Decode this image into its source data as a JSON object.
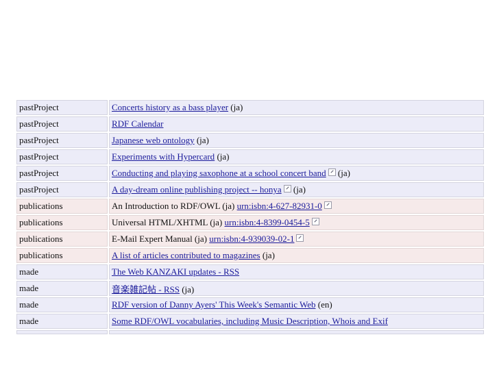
{
  "rows": [
    {
      "prop": "pastProject",
      "link": "Concerts history as a bass player",
      "suffix": " (ja)",
      "style": "a"
    },
    {
      "prop": "pastProject",
      "link": "RDF Calendar",
      "suffix": "",
      "style": "a"
    },
    {
      "prop": "pastProject",
      "link": "Japanese web ontology",
      "suffix": " (ja)",
      "style": "a"
    },
    {
      "prop": "pastProject",
      "link": "Experiments with Hypercard",
      "suffix": " (ja)",
      "style": "a"
    },
    {
      "prop": "pastProject",
      "link": "Conducting and playing saxophone at a school concert band",
      "ext": true,
      "suffix": " (ja)",
      "style": "a"
    },
    {
      "prop": "pastProject",
      "link": "A day-dream online publishing project -- honya",
      "ext": true,
      "suffix": " (ja)",
      "style": "a"
    },
    {
      "prop": "publications",
      "text": "An Introduction to RDF/OWL (ja) ",
      "link": "urn:isbn:4-627-82931-0",
      "ext": true,
      "suffix": "",
      "style": "b"
    },
    {
      "prop": "publications",
      "text": "Universal HTML/XHTML (ja) ",
      "link": "urn:isbn:4-8399-0454-5",
      "ext": true,
      "suffix": "",
      "style": "b"
    },
    {
      "prop": "publications",
      "text": "E-Mail Expert Manual (ja) ",
      "link": "urn:isbn:4-939039-02-1",
      "ext": true,
      "suffix": "",
      "style": "b"
    },
    {
      "prop": "publications",
      "link": "A list of articles contributed to magazines",
      "suffix": " (ja)",
      "style": "b"
    },
    {
      "prop": "made",
      "link": "The Web KANZAKI updates - RSS",
      "suffix": "",
      "style": "a"
    },
    {
      "prop": "made",
      "link": "音楽雑記帖 - RSS",
      "suffix": " (ja)",
      "style": "a"
    },
    {
      "prop": "made",
      "link": "RDF version of Danny Ayers' This Week's Semantic Web",
      "suffix": " (en)",
      "style": "a"
    },
    {
      "prop": "made",
      "link": "Some RDF/OWL vocabularies, including Music Description, Whois and Exif",
      "suffix": "",
      "style": "a"
    }
  ]
}
